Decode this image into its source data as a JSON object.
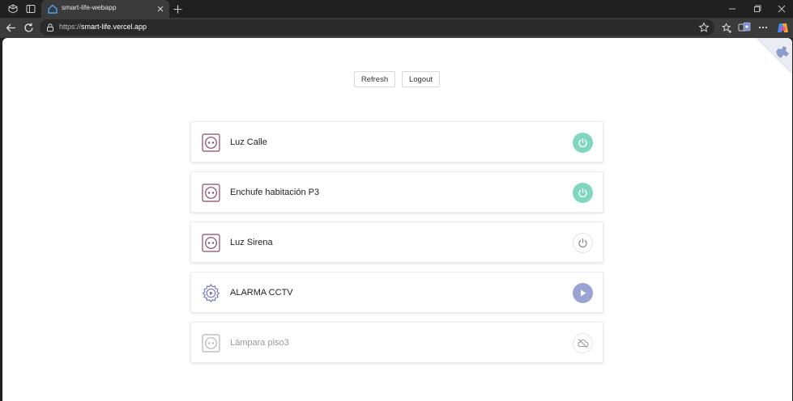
{
  "browser": {
    "tab_title": "smart-life-webapp",
    "url_prefix": "https://",
    "url_host": "smart-life.vercel.app"
  },
  "header": {
    "refresh_label": "Refresh",
    "logout_label": "Logout"
  },
  "devices": [
    {
      "name": "Luz Calle",
      "type": "socket-icon",
      "state": "on",
      "action_icon": "power-icon"
    },
    {
      "name": "Enchufe habitación P3",
      "type": "socket-icon",
      "state": "on",
      "action_icon": "power-icon"
    },
    {
      "name": "Luz Sirena",
      "type": "socket-icon",
      "state": "off",
      "action_icon": "power-icon"
    },
    {
      "name": "ALARMA CCTV",
      "type": "scene-gear-icon",
      "state": "scene",
      "action_icon": "play-icon"
    },
    {
      "name": "Lámpara piso3",
      "type": "socket-icon",
      "state": "offline",
      "action_icon": "cloud-offline-icon"
    }
  ],
  "colors": {
    "on": "#7fd7c0",
    "scene": "#9aa3d3",
    "socket_icon": "#8a4a5e",
    "gear_icon": "#6f74b4",
    "disabled": "#b5b5b5"
  }
}
